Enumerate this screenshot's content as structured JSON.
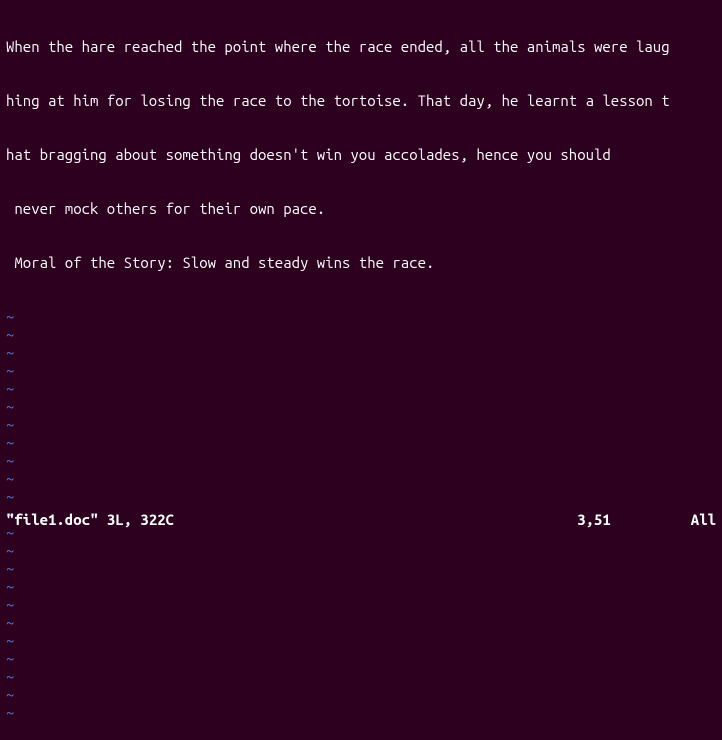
{
  "content": {
    "line1": "When the hare reached the point where the race ended, all the animals were laug",
    "line2": "hing at him for losing the race to the tortoise. That day, he learnt a lesson t",
    "line3": "hat bragging about something doesn't win you accolades, hence you should",
    "line4": " never mock others for their own pace.",
    "line5": " Moral of the Story: Slow and steady wins the race."
  },
  "tilde": "~",
  "tilde_count": 23,
  "status": {
    "filename": "\"file1.doc\"",
    "fileinfo": "3L, 322C",
    "position": "3,51",
    "scroll": "All"
  }
}
